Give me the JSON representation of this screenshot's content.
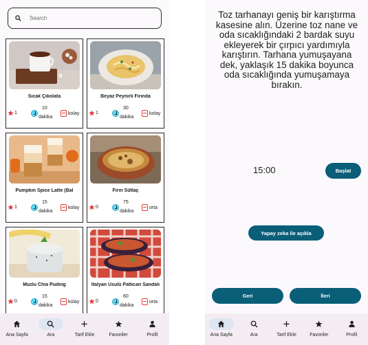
{
  "search": {
    "placeholder": "Search",
    "icon": "search-icon"
  },
  "recipes": [
    {
      "title": "Sıcak Çikolata",
      "stars": "1",
      "minutes": "10",
      "unit": "dakika",
      "difficulty": "kolay"
    },
    {
      "title": "Beyaz Peynirli Fırında",
      "stars": "1",
      "minutes": "30",
      "unit": "dakika",
      "difficulty": "kolay"
    },
    {
      "title": "Pumpkin Spice Latte (Bal",
      "stars": "1",
      "minutes": "15",
      "unit": "dakika",
      "difficulty": "kolay"
    },
    {
      "title": "Fırın Sütlaç",
      "stars": "0",
      "minutes": "75",
      "unit": "dakika",
      "difficulty": "orta"
    },
    {
      "title": "Muzlu Chia Puding",
      "stars": "0",
      "minutes": "15",
      "unit": "dakika",
      "difficulty": "kolay"
    },
    {
      "title": "İtalyan Usulü Patlıcan Sandalı",
      "stars": "0",
      "minutes": "60",
      "unit": "dakika",
      "difficulty": "orta"
    }
  ],
  "nav": {
    "home": "Ana Sayfa",
    "search": "Ara",
    "add": "Tarif Ekle",
    "favorites": "Favoriler",
    "profile": "Profil"
  },
  "step": {
    "instruction": "Toz tarhanayı geniş bir karıştırma kasesine alın. Üzerine toz nane ve oda sıcaklığındaki 2 bardak suyu ekleyerek bir çırpıcı yardımıyla karıştırın. Tarhana yumuşayana dek, yaklaşık 15 dakika boyunca oda sıcaklığında yumuşamaya bırakın.",
    "timer": "15:00",
    "start_label": "Başlat",
    "ai_label": "Yapay zeka ile açıkla",
    "back_label": "Geri",
    "next_label": "İleri"
  },
  "colors": {
    "accent": "#0a5e78",
    "star": "#e53935",
    "clock": "#63d6f0",
    "nav_active": "#dde6f2"
  }
}
